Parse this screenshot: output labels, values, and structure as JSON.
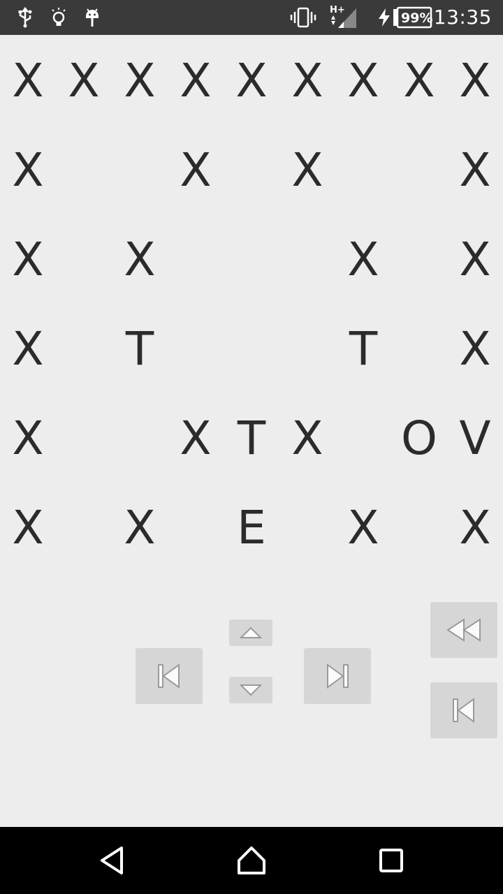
{
  "status_bar": {
    "time": "13:35",
    "battery": "99%",
    "network": "H+",
    "icons": [
      "usb-icon",
      "bulb-icon",
      "android-debug-icon",
      "vibrate-icon",
      "signal-icon",
      "charging-icon",
      "battery-icon"
    ]
  },
  "maze": {
    "rows": [
      [
        "X",
        "X",
        "X",
        "X",
        "X",
        "X",
        "X",
        "X",
        "X"
      ],
      [
        "X",
        "",
        "",
        "X",
        "",
        "X",
        "",
        "",
        "X"
      ],
      [
        "X",
        "",
        "X",
        "",
        "",
        "",
        "X",
        "",
        "X"
      ],
      [
        "X",
        "",
        "T",
        "",
        "",
        "",
        "T",
        "",
        "X"
      ],
      [
        "X",
        "",
        "",
        "X",
        "T",
        "X",
        "",
        "O",
        "V"
      ],
      [
        "X",
        "",
        "X",
        "",
        "E",
        "",
        "X",
        "",
        "X"
      ]
    ]
  },
  "controls": {
    "icons": {
      "up": "arrow-up-icon",
      "down": "arrow-down-icon",
      "prev": "skip-previous-icon",
      "next": "skip-next-icon",
      "rewind": "rewind-icon",
      "restart": "skip-to-start-icon"
    }
  },
  "nav_bar": {
    "icons": [
      "back-icon",
      "home-icon",
      "recents-icon"
    ]
  },
  "colors": {
    "background": "#ededed",
    "status_bar": "#3a3a3a",
    "nav_bar": "#000000",
    "glyph": "#2b2b2b",
    "button": "#d6d6d6"
  }
}
